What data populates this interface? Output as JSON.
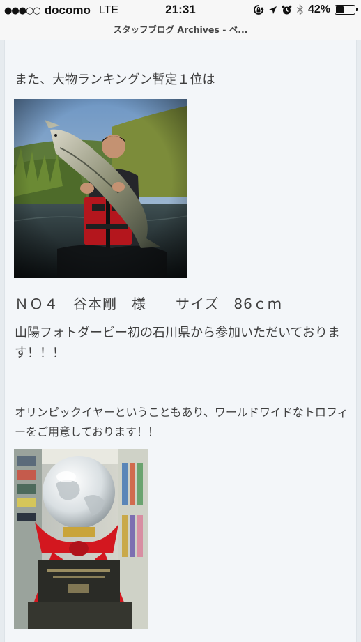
{
  "status_bar": {
    "signal": "●●●○○",
    "carrier": "docomo",
    "network": "LTE",
    "time": "21:31",
    "battery_percent": "42%",
    "battery_level": 0.42,
    "icons": [
      "screen-lock-icon",
      "location-arrow-icon",
      "alarm-icon",
      "bluetooth-icon",
      "battery-icon"
    ]
  },
  "page": {
    "title": "スタッフブログ Archives - ベ..."
  },
  "article": {
    "intro": "また、大物ランキングン暫定１位は",
    "winner_line": "ＮＯ４　谷本剛　様　　サイズ　86ｃｍ",
    "winner_note": "山陽フォトダービー初の石川県から参加いただいております！！！",
    "trophy_note": "オリンピックイヤーということもあり、ワールドワイドなトロフィーをご用意しております！！"
  },
  "colors": {
    "background": "#f3f6f9",
    "text": "#3f3f3f",
    "chrome": "#f7f7f7"
  }
}
